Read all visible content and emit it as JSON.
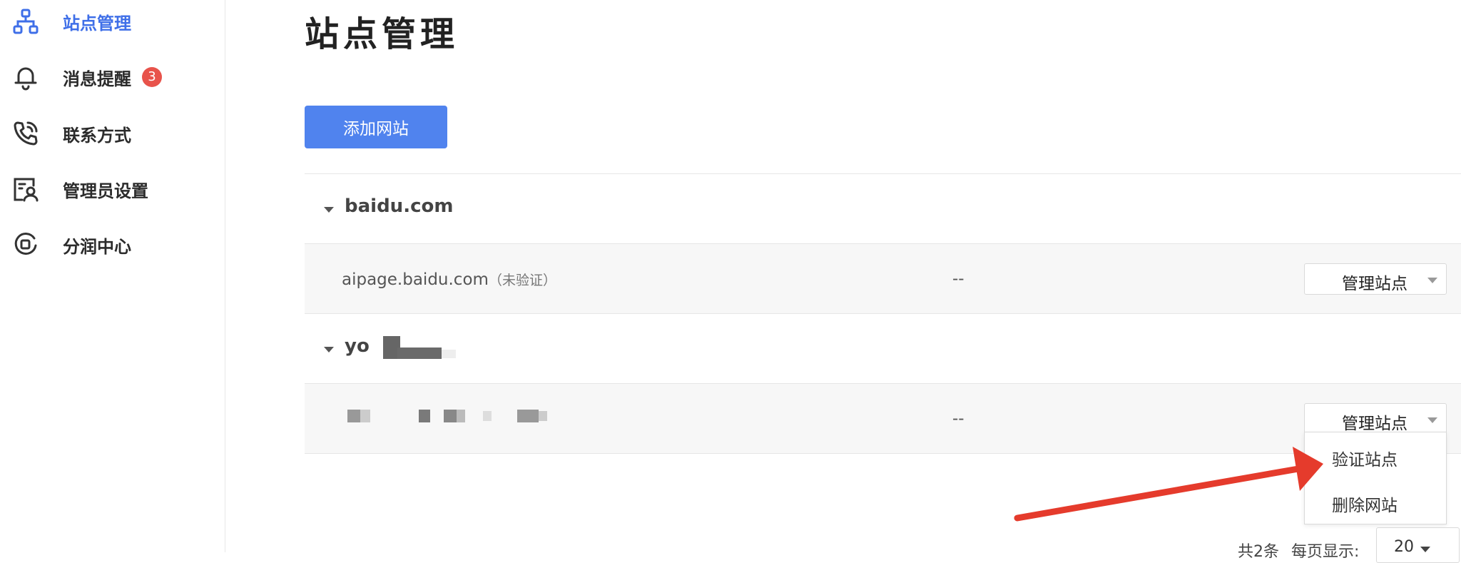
{
  "sidebar": {
    "items": [
      {
        "label": "站点管理",
        "icon": "sitemap-icon",
        "active": true
      },
      {
        "label": "消息提醒",
        "icon": "bell-icon",
        "badge": "3"
      },
      {
        "label": "联系方式",
        "icon": "phone-icon"
      },
      {
        "label": "管理员设置",
        "icon": "admin-icon"
      },
      {
        "label": "分润中心",
        "icon": "revenue-icon"
      }
    ]
  },
  "page": {
    "title": "站点管理",
    "add_button": "添加网站"
  },
  "groups": [
    {
      "domain": "baidu.com",
      "sites": [
        {
          "name": "aipage.baidu.com",
          "status": "（未验证）",
          "value": "--",
          "action": "管理站点"
        }
      ]
    },
    {
      "domain": "yo",
      "sites": [
        {
          "name": "",
          "status": "",
          "value": "--",
          "action": "管理站点"
        }
      ]
    }
  ],
  "dropdown": {
    "items": [
      "验证站点",
      "删除网站"
    ]
  },
  "pagination": {
    "total": "共2条",
    "per_page_label": "每页显示:",
    "per_page_value": "20"
  },
  "colors": {
    "accent": "#5083ee",
    "active_nav": "#3f6fe8",
    "badge": "#e8534b",
    "annotation_arrow": "#e53b2c"
  }
}
